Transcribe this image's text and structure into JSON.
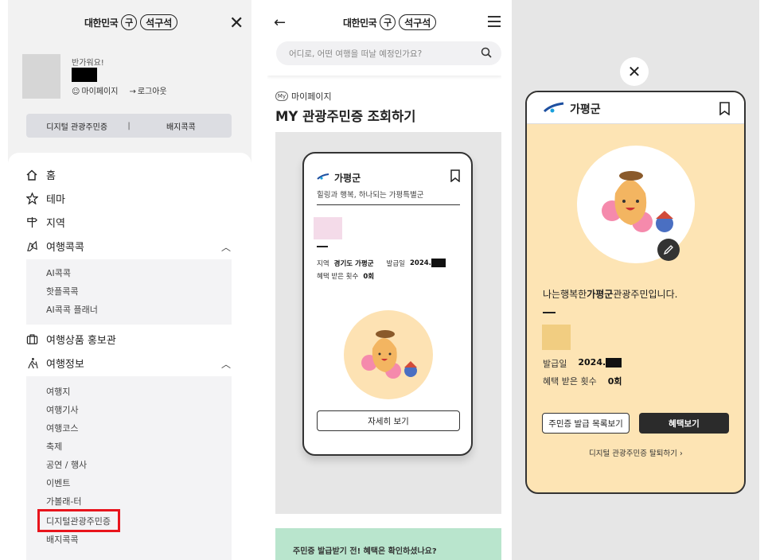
{
  "logo": {
    "left": "대한민국",
    "ring": "구",
    "pill": "석구석"
  },
  "menu_panel": {
    "greeting": "반가워요!",
    "mypage_label": "마이페이지",
    "logout_label": "로그아웃",
    "tabs": [
      "디지털 관광주민증",
      "배지콕콕"
    ],
    "tab_separator": "|",
    "items": [
      {
        "label": "홈",
        "icon": "home-icon"
      },
      {
        "label": "테마",
        "icon": "star-icon"
      },
      {
        "label": "지역",
        "icon": "signpost-icon"
      },
      {
        "label": "여행콕콕",
        "icon": "map-pin-icon"
      },
      {
        "label": "여행상품 홍보관",
        "icon": "suitcase-icon"
      },
      {
        "label": "여행정보",
        "icon": "hiker-icon"
      }
    ],
    "sub_kokok": [
      "AI콕콕",
      "핫플콕콕",
      "AI콕콕 플래너"
    ],
    "sub_info": [
      "여행지",
      "여행기사",
      "여행코스",
      "축제",
      "공연 / 행사",
      "이벤트",
      "가볼래-터",
      "디지털관광주민증",
      "배지콕콕"
    ]
  },
  "mypage_panel": {
    "search_placeholder": "어디로, 어떤 여행을 떠날 예정인가요?",
    "my_badge": "My",
    "breadcrumb": "마이페이지",
    "title": "MY 관광주민증 조회하기",
    "card": {
      "region_name": "가평군",
      "slogan": "힐링과 행복, 하나되는 가평특별군",
      "region_label": "지역",
      "region_value": "경기도 가평군",
      "issue_label": "발급일",
      "issue_value": "2024.",
      "benefit_label": "혜택 받은 횟수",
      "benefit_value": "0회",
      "detail_button": "자세히 보기"
    },
    "banner_text": "주민증 발급받기 전! 혜택은 확인하셨나요?"
  },
  "detail_panel": {
    "region_name": "가평군",
    "resident_prefix": "나는행복한",
    "resident_region": "가평군",
    "resident_suffix": "관광주민입니다.",
    "issue_label": "발급일",
    "issue_value": "2024.",
    "benefit_label": "혜택 받은 횟수",
    "benefit_value": "0회",
    "list_button": "주민증 발급 목록보기",
    "benefit_button": "혜택보기",
    "withdraw_link": "디지털 관광주민증 탈퇴하기 ›"
  },
  "colors": {
    "highlight_red": "#e8141c",
    "card_bg": "#fde4b4",
    "banner_green": "#b9e5cd"
  }
}
